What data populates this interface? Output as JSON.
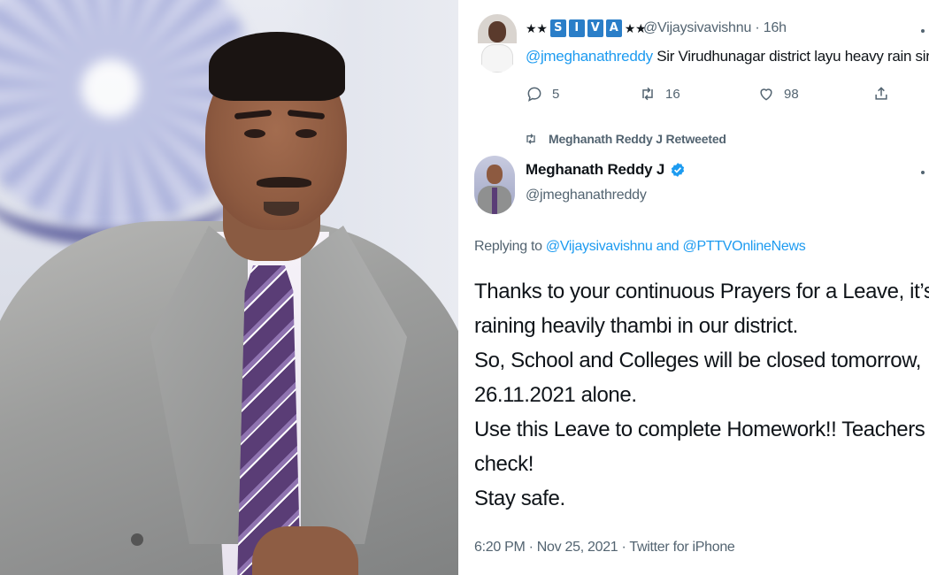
{
  "tweet1": {
    "name_prefix": "★★",
    "name_letters": [
      "S",
      "I",
      "V",
      "A"
    ],
    "name_suffix": "★★",
    "handle": "@Vijaysivavishnu",
    "time": "· 16h",
    "mention": "@jmeghanathreddy",
    "text": " Sir Virudhunagar district layu heavy rain sir..🙏💯",
    "replies": "5",
    "retweets": "16",
    "likes": "98"
  },
  "retweet_label": "Meghanath Reddy J Retweeted",
  "tweet2": {
    "name": "Meghanath Reddy J",
    "handle": "@jmeghanathreddy",
    "replying_prefix": "Replying to ",
    "replying_user1": "@Vijaysivavishnu",
    "replying_and": " and ",
    "replying_user2": "@PTTVOnlineNews",
    "lines": [
      "Thanks to your continuous Prayers for a Leave, it’s",
      "raining heavily thambi in our district.",
      "So, School and Colleges will be closed tomorrow,",
      "26.11.2021 alone.",
      "Use this Leave to complete Homework!! Teachers will",
      "check!",
      "Stay safe."
    ],
    "meta": "6:20 PM · Nov 25, 2021 · Twitter for iPhone"
  },
  "icons": {
    "reply": "reply-icon",
    "retweet": "retweet-icon",
    "like": "heart-icon",
    "share": "share-icon",
    "verified": "verified-badge-icon",
    "more": "more-dots-icon"
  },
  "colors": {
    "link": "#1d9bf0",
    "muted": "#536471",
    "text": "#0f1419",
    "name_box": "#2a7ec8"
  }
}
